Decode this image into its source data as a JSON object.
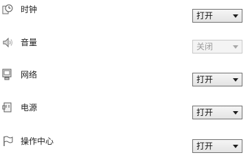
{
  "notification_settings": {
    "rows": [
      {
        "label": "时钟",
        "icon": "clock-icon",
        "value": "打开",
        "enabled": true
      },
      {
        "label": "音量",
        "icon": "speaker-icon",
        "value": "关闭",
        "enabled": false
      },
      {
        "label": "网络",
        "icon": "network-icon",
        "value": "打开",
        "enabled": true
      },
      {
        "label": "电源",
        "icon": "power-plug-icon",
        "value": "打开",
        "enabled": true
      },
      {
        "label": "操作中心",
        "icon": "flag-icon",
        "value": "打开",
        "enabled": true
      }
    ]
  }
}
